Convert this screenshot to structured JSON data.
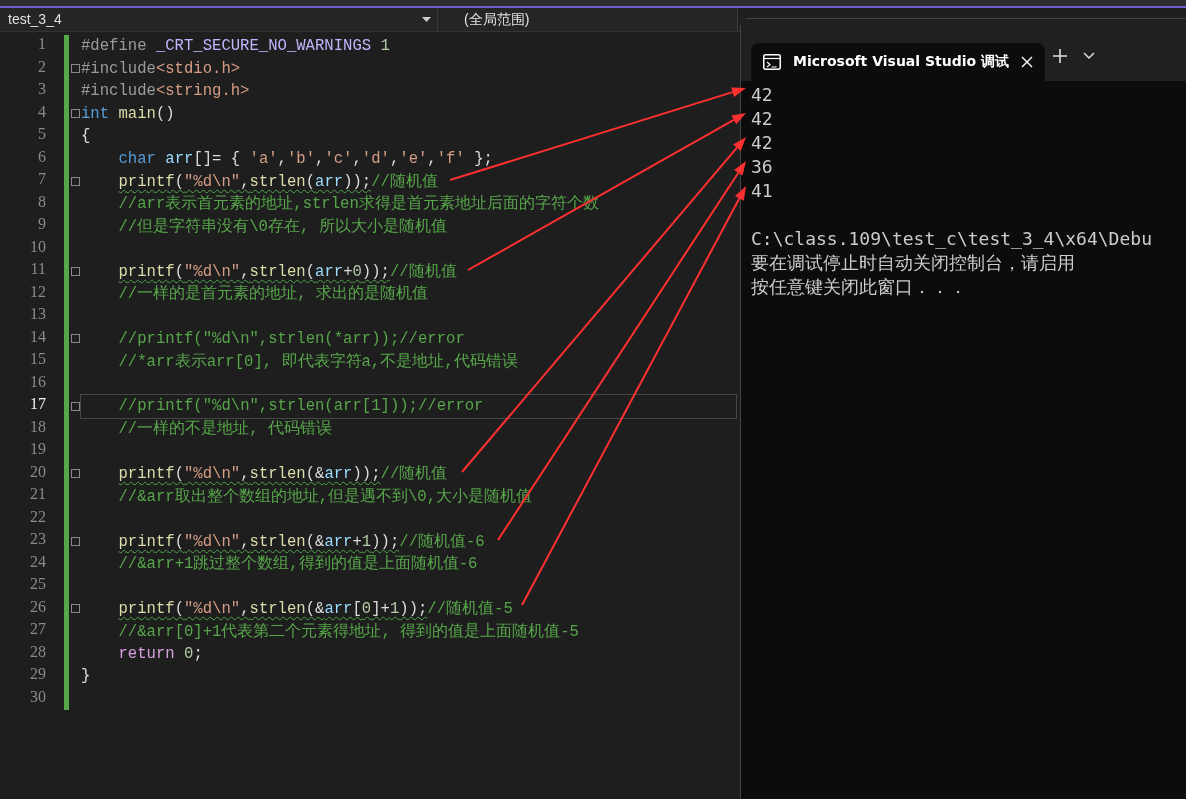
{
  "editor": {
    "file_dropdown": "test_3_4",
    "scope_dropdown": "(全局范围)",
    "lines": [
      {
        "number": "1",
        "fold": false,
        "current": false,
        "squiggle": false,
        "indented": false,
        "tokens": [
          {
            "kind": "pre",
            "text": "#define "
          },
          {
            "kind": "macro",
            "text": "_CRT_SECURE_NO_WARNINGS"
          },
          {
            "kind": "num",
            "text": " 1"
          }
        ]
      },
      {
        "number": "2",
        "fold": true,
        "current": false,
        "squiggle": false,
        "indented": false,
        "tokens": [
          {
            "kind": "pre",
            "text": "#include"
          },
          {
            "kind": "str",
            "text": "<stdio.h>"
          }
        ]
      },
      {
        "number": "3",
        "fold": false,
        "current": false,
        "squiggle": false,
        "indented": false,
        "tokens": [
          {
            "kind": "pre",
            "text": "#include"
          },
          {
            "kind": "str",
            "text": "<string.h>"
          }
        ]
      },
      {
        "number": "4",
        "fold": true,
        "current": false,
        "squiggle": false,
        "indented": false,
        "tokens": [
          {
            "kind": "kw",
            "text": "int"
          },
          {
            "kind": "fn",
            "text": " main"
          },
          {
            "kind": "plain",
            "text": "()"
          }
        ]
      },
      {
        "number": "5",
        "fold": false,
        "current": false,
        "squiggle": false,
        "indented": false,
        "tokens": [
          {
            "kind": "plain",
            "text": "{"
          }
        ]
      },
      {
        "number": "6",
        "fold": false,
        "current": false,
        "squiggle": false,
        "indented": true,
        "tokens": [
          {
            "kind": "kw",
            "text": "char"
          },
          {
            "kind": "var",
            "text": " arr"
          },
          {
            "kind": "plain",
            "text": "[]= { "
          },
          {
            "kind": "str",
            "text": "'a'"
          },
          {
            "kind": "plain",
            "text": ","
          },
          {
            "kind": "str",
            "text": "'b'"
          },
          {
            "kind": "plain",
            "text": ","
          },
          {
            "kind": "str",
            "text": "'c'"
          },
          {
            "kind": "plain",
            "text": ","
          },
          {
            "kind": "str",
            "text": "'d'"
          },
          {
            "kind": "plain",
            "text": ","
          },
          {
            "kind": "str",
            "text": "'e'"
          },
          {
            "kind": "plain",
            "text": ","
          },
          {
            "kind": "str",
            "text": "'f'"
          },
          {
            "kind": "plain",
            "text": " };"
          }
        ]
      },
      {
        "number": "7",
        "fold": true,
        "current": false,
        "squiggle": true,
        "indented": true,
        "tokens": [
          {
            "kind": "fn",
            "text": "printf"
          },
          {
            "kind": "plain",
            "text": "("
          },
          {
            "kind": "str",
            "text": "\"%d\\n\""
          },
          {
            "kind": "plain",
            "text": ","
          },
          {
            "kind": "fn",
            "text": "strlen"
          },
          {
            "kind": "plain",
            "text": "("
          },
          {
            "kind": "var",
            "text": "arr"
          },
          {
            "kind": "plain",
            "text": "));"
          },
          {
            "kind": "cmt",
            "text": "//随机值"
          }
        ]
      },
      {
        "number": "8",
        "fold": false,
        "current": false,
        "squiggle": false,
        "indented": true,
        "tokens": [
          {
            "kind": "cmt",
            "text": "//arr表示首元素的地址,strlen求得是首元素地址后面的字符个数"
          }
        ]
      },
      {
        "number": "9",
        "fold": false,
        "current": false,
        "squiggle": false,
        "indented": true,
        "tokens": [
          {
            "kind": "cmt",
            "text": "//但是字符串没有\\0存在, 所以大小是随机值"
          }
        ]
      },
      {
        "number": "10",
        "fold": false,
        "current": false,
        "squiggle": false
      },
      {
        "number": "11",
        "fold": true,
        "current": false,
        "squiggle": true,
        "indented": true,
        "tokens": [
          {
            "kind": "fn",
            "text": "printf"
          },
          {
            "kind": "plain",
            "text": "("
          },
          {
            "kind": "str",
            "text": "\"%d\\n\""
          },
          {
            "kind": "plain",
            "text": ","
          },
          {
            "kind": "fn",
            "text": "strlen"
          },
          {
            "kind": "plain",
            "text": "("
          },
          {
            "kind": "var",
            "text": "arr"
          },
          {
            "kind": "plain",
            "text": "+"
          },
          {
            "kind": "num",
            "text": "0"
          },
          {
            "kind": "plain",
            "text": "));"
          },
          {
            "kind": "cmt",
            "text": "//随机值"
          }
        ]
      },
      {
        "number": "12",
        "fold": false,
        "current": false,
        "squiggle": false,
        "indented": true,
        "tokens": [
          {
            "kind": "cmt",
            "text": "//一样的是首元素的地址, 求出的是随机值"
          }
        ]
      },
      {
        "number": "13",
        "fold": false,
        "current": false,
        "squiggle": false
      },
      {
        "number": "14",
        "fold": true,
        "current": false,
        "squiggle": false,
        "indented": true,
        "tokens": [
          {
            "kind": "cmt",
            "text": "//printf(\"%d\\n\",strlen(*arr));//error"
          }
        ]
      },
      {
        "number": "15",
        "fold": false,
        "current": false,
        "squiggle": false,
        "indented": true,
        "tokens": [
          {
            "kind": "cmt",
            "text": "//*arr表示arr[0], 即代表字符a,不是地址,代码错误"
          }
        ]
      },
      {
        "number": "16",
        "fold": false,
        "current": false,
        "squiggle": false
      },
      {
        "number": "17",
        "fold": true,
        "current": true,
        "squiggle": false,
        "indented": true,
        "tokens": [
          {
            "kind": "cmt",
            "text": "//printf(\"%d\\n\",strlen(arr[1]));//error"
          }
        ]
      },
      {
        "number": "18",
        "fold": false,
        "current": false,
        "squiggle": false,
        "indented": true,
        "tokens": [
          {
            "kind": "cmt",
            "text": "//一样的不是地址, 代码错误"
          }
        ]
      },
      {
        "number": "19",
        "fold": false,
        "current": false,
        "squiggle": false
      },
      {
        "number": "20",
        "fold": true,
        "current": false,
        "squiggle": true,
        "indented": true,
        "tokens": [
          {
            "kind": "fn",
            "text": "printf"
          },
          {
            "kind": "plain",
            "text": "("
          },
          {
            "kind": "str",
            "text": "\"%d\\n\""
          },
          {
            "kind": "plain",
            "text": ","
          },
          {
            "kind": "fn",
            "text": "strlen"
          },
          {
            "kind": "plain",
            "text": "(&"
          },
          {
            "kind": "var",
            "text": "arr"
          },
          {
            "kind": "plain",
            "text": "));"
          },
          {
            "kind": "cmt",
            "text": "//随机值"
          }
        ]
      },
      {
        "number": "21",
        "fold": false,
        "current": false,
        "squiggle": false,
        "indented": true,
        "tokens": [
          {
            "kind": "cmt",
            "text": "//&arr取出整个数组的地址,但是遇不到\\0,大小是随机值"
          }
        ]
      },
      {
        "number": "22",
        "fold": false,
        "current": false,
        "squiggle": false
      },
      {
        "number": "23",
        "fold": true,
        "current": false,
        "squiggle": true,
        "indented": true,
        "tokens": [
          {
            "kind": "fn",
            "text": "printf"
          },
          {
            "kind": "plain",
            "text": "("
          },
          {
            "kind": "str",
            "text": "\"%d\\n\""
          },
          {
            "kind": "plain",
            "text": ","
          },
          {
            "kind": "fn",
            "text": "strlen"
          },
          {
            "kind": "plain",
            "text": "(&"
          },
          {
            "kind": "var",
            "text": "arr"
          },
          {
            "kind": "plain",
            "text": "+"
          },
          {
            "kind": "num",
            "text": "1"
          },
          {
            "kind": "plain",
            "text": "));"
          },
          {
            "kind": "cmt",
            "text": "//随机值-6"
          }
        ]
      },
      {
        "number": "24",
        "fold": false,
        "current": false,
        "squiggle": false,
        "indented": true,
        "tokens": [
          {
            "kind": "cmt",
            "text": "//&arr+1跳过整个数组,得到的值是上面随机值-6"
          }
        ]
      },
      {
        "number": "25",
        "fold": false,
        "current": false,
        "squiggle": false
      },
      {
        "number": "26",
        "fold": true,
        "current": false,
        "squiggle": true,
        "indented": true,
        "tokens": [
          {
            "kind": "fn",
            "text": "printf"
          },
          {
            "kind": "plain",
            "text": "("
          },
          {
            "kind": "str",
            "text": "\"%d\\n\""
          },
          {
            "kind": "plain",
            "text": ","
          },
          {
            "kind": "fn",
            "text": "strlen"
          },
          {
            "kind": "plain",
            "text": "(&"
          },
          {
            "kind": "var",
            "text": "arr"
          },
          {
            "kind": "plain",
            "text": "["
          },
          {
            "kind": "num",
            "text": "0"
          },
          {
            "kind": "plain",
            "text": "]+"
          },
          {
            "kind": "num",
            "text": "1"
          },
          {
            "kind": "plain",
            "text": "));"
          },
          {
            "kind": "cmt",
            "text": "//随机值-5"
          }
        ]
      },
      {
        "number": "27",
        "fold": false,
        "current": false,
        "squiggle": false,
        "indented": true,
        "tokens": [
          {
            "kind": "cmt",
            "text": "//&arr[0]+1代表第二个元素得地址, 得到的值是上面随机值-5"
          }
        ]
      },
      {
        "number": "28",
        "fold": false,
        "current": false,
        "squiggle": false,
        "indented": true,
        "tokens": [
          {
            "kind": "ret",
            "text": "return"
          },
          {
            "kind": "num",
            "text": " 0"
          },
          {
            "kind": "plain",
            "text": ";"
          }
        ]
      },
      {
        "number": "29",
        "fold": false,
        "current": false,
        "squiggle": false,
        "indented": false,
        "tokens": [
          {
            "kind": "plain",
            "text": "}"
          }
        ]
      },
      {
        "number": "30",
        "fold": false,
        "current": false,
        "squiggle": false
      }
    ]
  },
  "console": {
    "tab_title": "Microsoft Visual Studio 调试",
    "output": [
      "42",
      "42",
      "42",
      "36",
      "41",
      "C:\\class.109\\test_c\\test_3_4\\x64\\Debu",
      "要在调试停止时自动关闭控制台，请启用",
      "按任意键关闭此窗口．．．"
    ]
  }
}
